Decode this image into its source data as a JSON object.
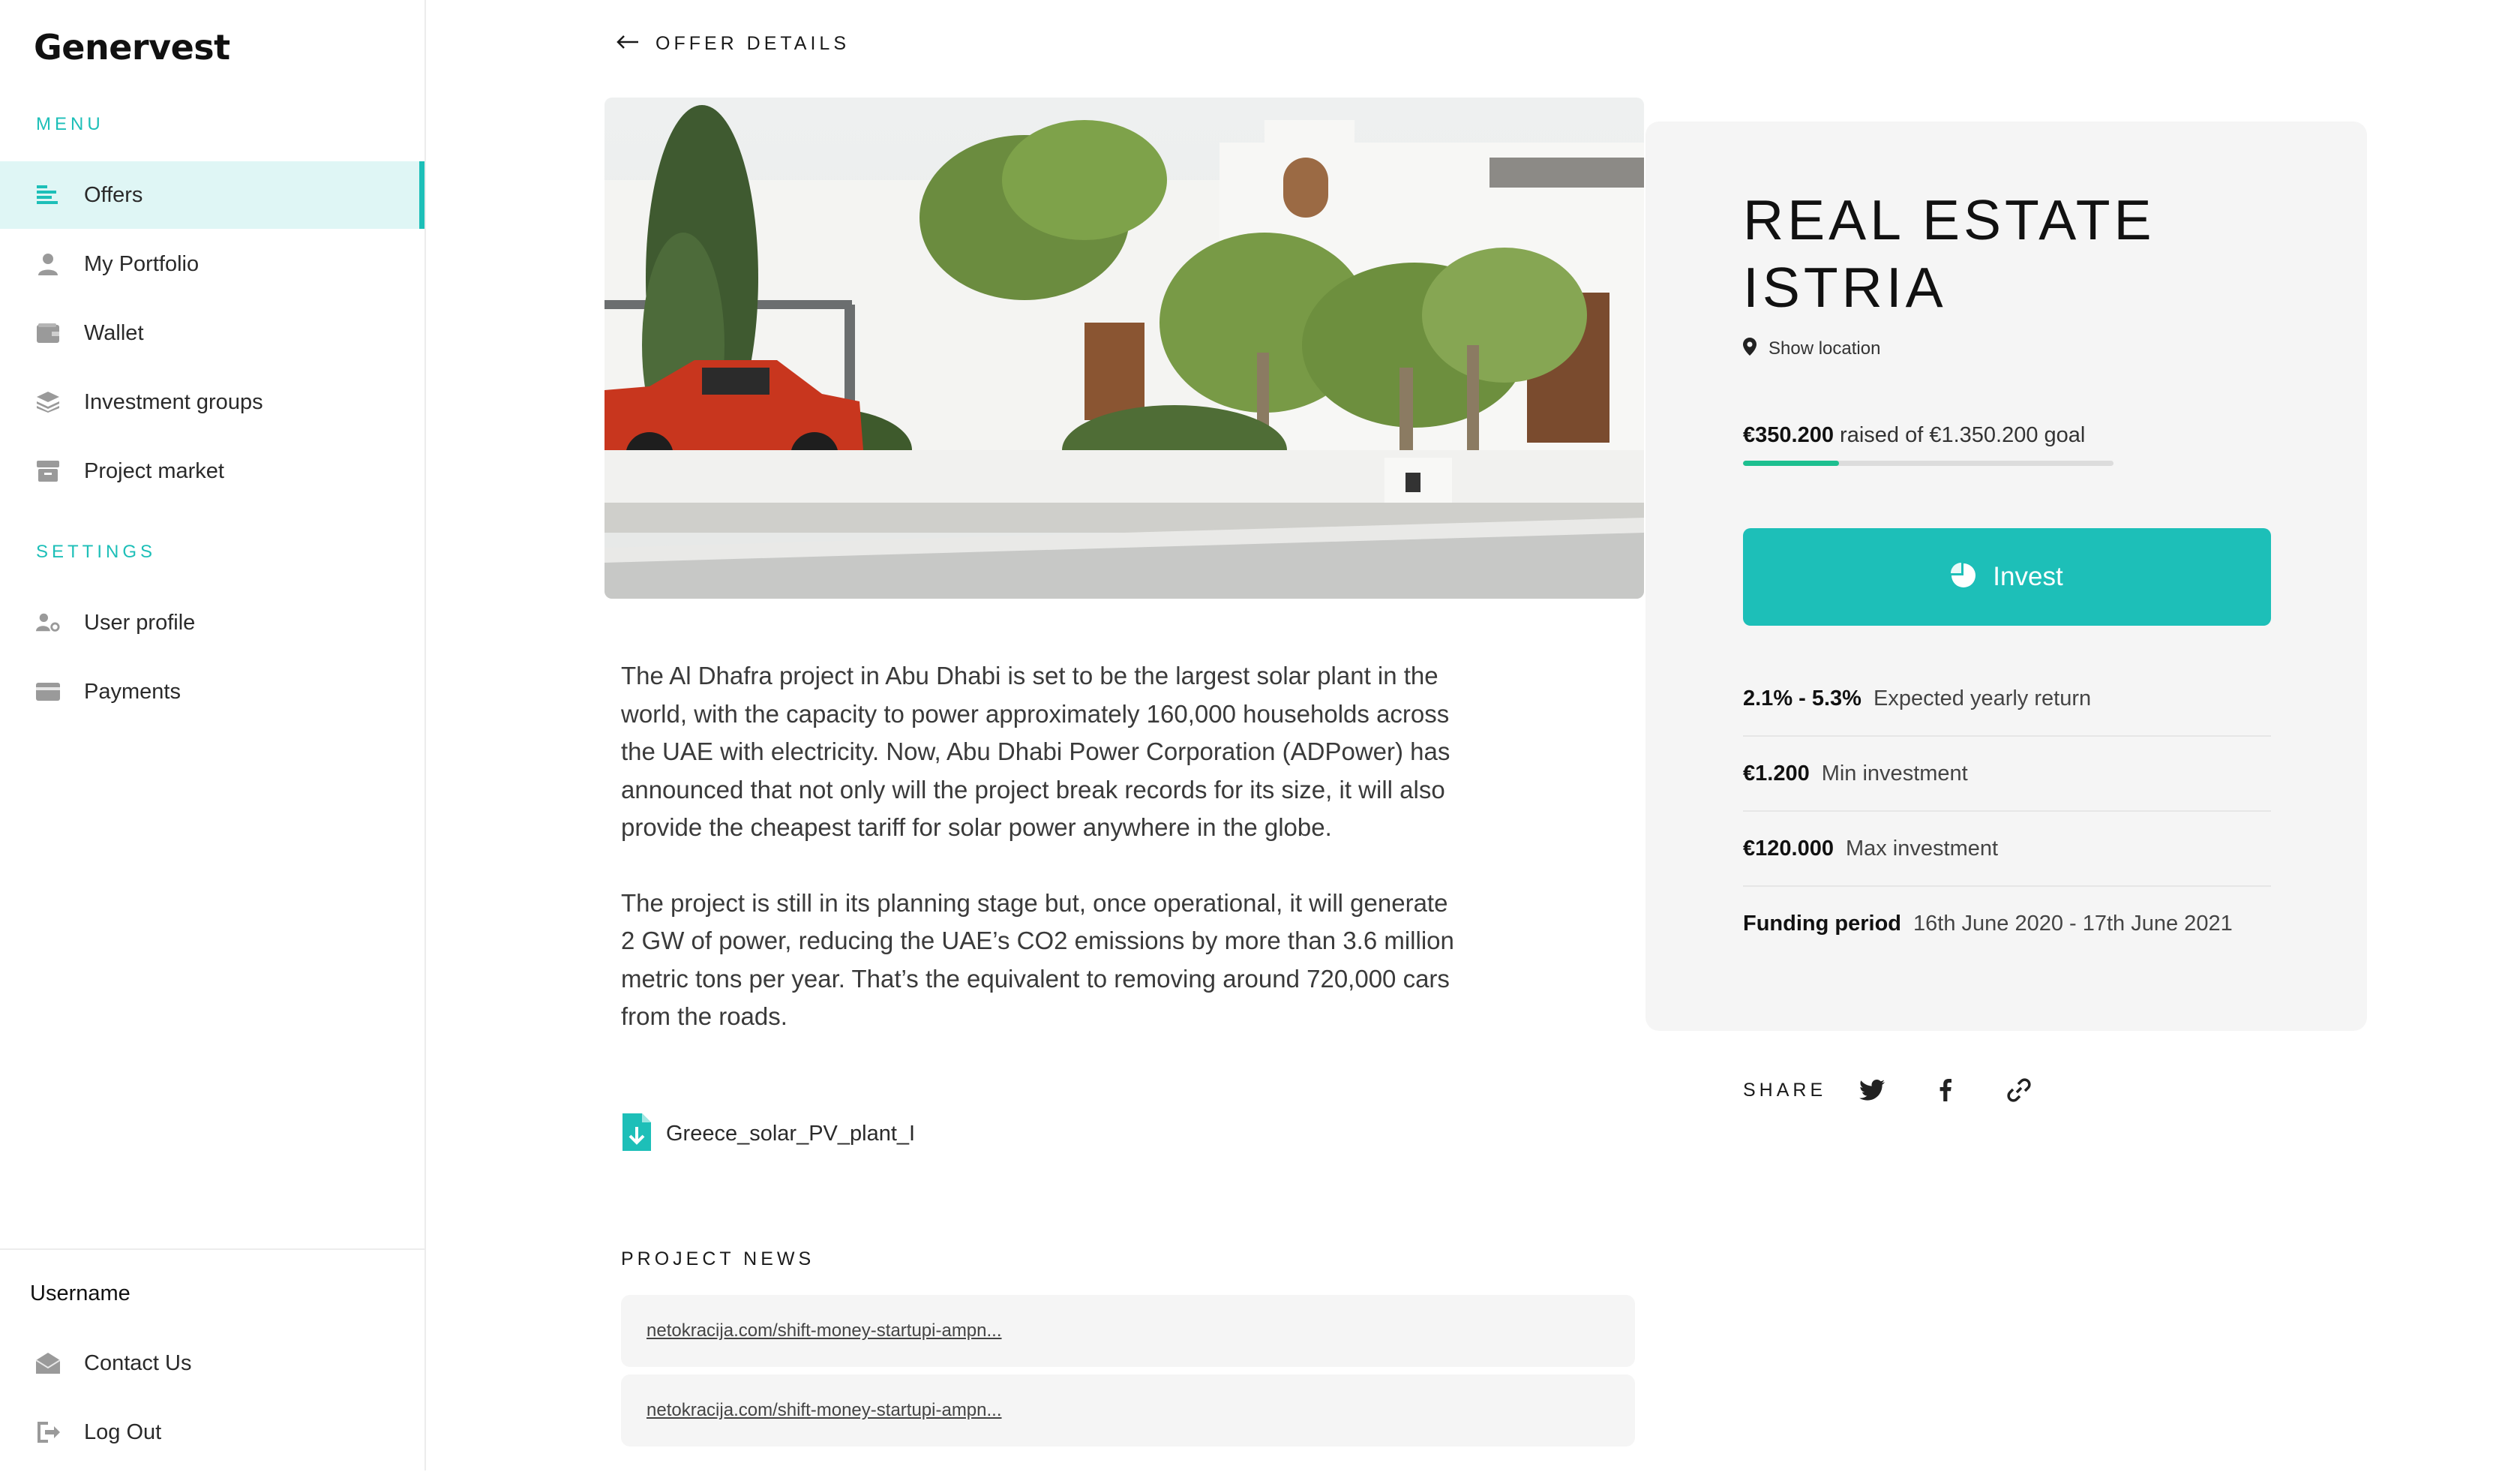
{
  "app": {
    "brand": "Genervest"
  },
  "sidebar": {
    "menu_label": "MENU",
    "settings_label": "SETTINGS",
    "menu_items": [
      {
        "label": "Offers",
        "icon": "list-icon",
        "active": true
      },
      {
        "label": "My Portfolio",
        "icon": "user-icon"
      },
      {
        "label": "Wallet",
        "icon": "wallet-icon"
      },
      {
        "label": "Investment groups",
        "icon": "layers-icon"
      },
      {
        "label": "Project market",
        "icon": "store-icon"
      }
    ],
    "settings_items": [
      {
        "label": "User profile",
        "icon": "user-settings-icon"
      },
      {
        "label": "Payments",
        "icon": "credit-card-icon"
      }
    ],
    "username": "Username",
    "bottom_items": [
      {
        "label": "Contact Us",
        "icon": "mail-icon"
      },
      {
        "label": "Log Out",
        "icon": "logout-icon"
      }
    ]
  },
  "header": {
    "back_label": "OFFER DETAILS"
  },
  "offer": {
    "title_line1": "REAL ESTATE",
    "title_line2": "ISTRIA",
    "location_label": "Show location",
    "raised_amount": "€350.200",
    "raised_text": "raised of €1.350.200 goal",
    "progress": 0.26,
    "invest_label": "Invest",
    "stats": [
      {
        "value": "2.1% - 5.3%",
        "label": "Expected yearly return"
      },
      {
        "value": "€1.200",
        "label": "Min investment"
      },
      {
        "value": "€120.000",
        "label": "Max investment"
      },
      {
        "value": "Funding period",
        "label": "16th June 2020 - 17th June 2021"
      }
    ],
    "share_label": "SHARE",
    "share_icons": [
      "twitter-icon",
      "facebook-icon",
      "link-icon"
    ]
  },
  "description": {
    "p1": "The Al Dhafra project in Abu Dhabi is set to be the largest solar plant in the world, with the capacity to power approximately 160,000 households across the UAE with electricity. Now, Abu Dhabi Power Corporation (ADPower) has announced that not only will the project break records for its size, it will also provide the cheapest tariff for solar power anywhere in the globe.",
    "p2": "The project is still in its planning stage but, once operational, it will generate 2 GW of power, reducing the UAE’s CO2 emissions by more than 3.6 million metric tons per year. That’s the equivalent to removing around 720,000 cars from the roads."
  },
  "attachment": {
    "filename": "Greece_solar_PV_plant_I"
  },
  "news": {
    "title": "PROJECT NEWS",
    "items": [
      "netokracija.com/shift-money-startupi-ampn...",
      "netokracija.com/shift-money-startupi-ampn..."
    ]
  },
  "colors": {
    "accent": "#1dbfb8",
    "progress": "#1dbf8f",
    "card_bg": "#f5f5f5"
  }
}
